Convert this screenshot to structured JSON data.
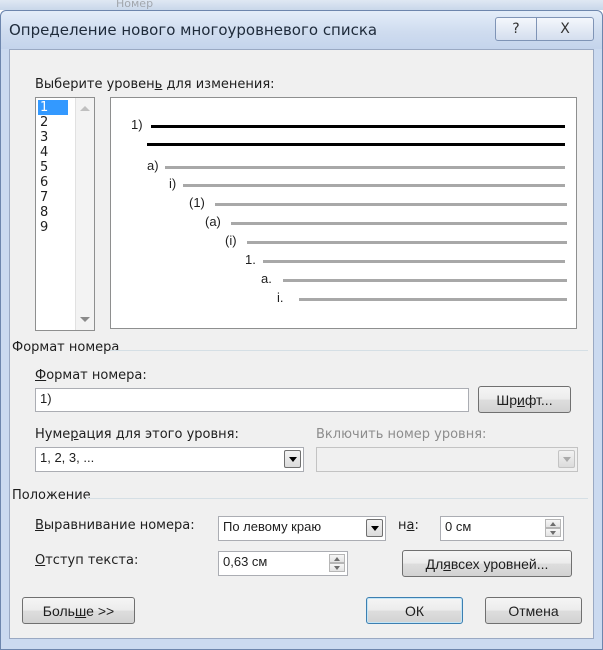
{
  "background_hint": "Номер",
  "dialog": {
    "title": "Определение нового многоуровневого списка",
    "help_glyph": "?",
    "close_glyph": "X"
  },
  "level_select": {
    "label_pre": "Выберите уровен",
    "label_u": "ь",
    "label_post": " для изменения:",
    "items": [
      "1",
      "2",
      "3",
      "4",
      "5",
      "6",
      "7",
      "8",
      "9"
    ],
    "selected": "1"
  },
  "preview": {
    "labels": [
      "1)",
      "a)",
      "i)",
      "(1)",
      "(a)",
      "(i)",
      "1.",
      "a.",
      "i."
    ]
  },
  "number_format": {
    "group_title": "Формат номера",
    "field_label_u": "Ф",
    "field_label_rest": "ормат номера:",
    "field_value": "1)",
    "font_button_pre": "Шр",
    "font_button_u": "и",
    "font_button_post": "фт...",
    "numbering_label_pre": "Нуме",
    "numbering_label_u": "р",
    "numbering_label_post": "ация для этого уровня:",
    "numbering_value": "1, 2, 3, ...",
    "include_label": "Включить номер уровня:",
    "include_value": ""
  },
  "position": {
    "group_title": "Положение",
    "align_label_u": "В",
    "align_label_rest": "ыравнивание номера:",
    "align_value": "По левому краю",
    "at_label_pre": "н",
    "at_label_u": "а",
    "at_label_post": ":",
    "at_value": "0 см",
    "indent_label_u": "О",
    "indent_label_rest": "тступ текста:",
    "indent_value": "0,63 см",
    "all_levels_pre": "Дл",
    "all_levels_u": "я",
    "all_levels_post": " всех уровней..."
  },
  "footer": {
    "more_pre": "Боль",
    "more_u": "ш",
    "more_post": "е >>",
    "ok": "ОК",
    "cancel": "Отмена"
  }
}
